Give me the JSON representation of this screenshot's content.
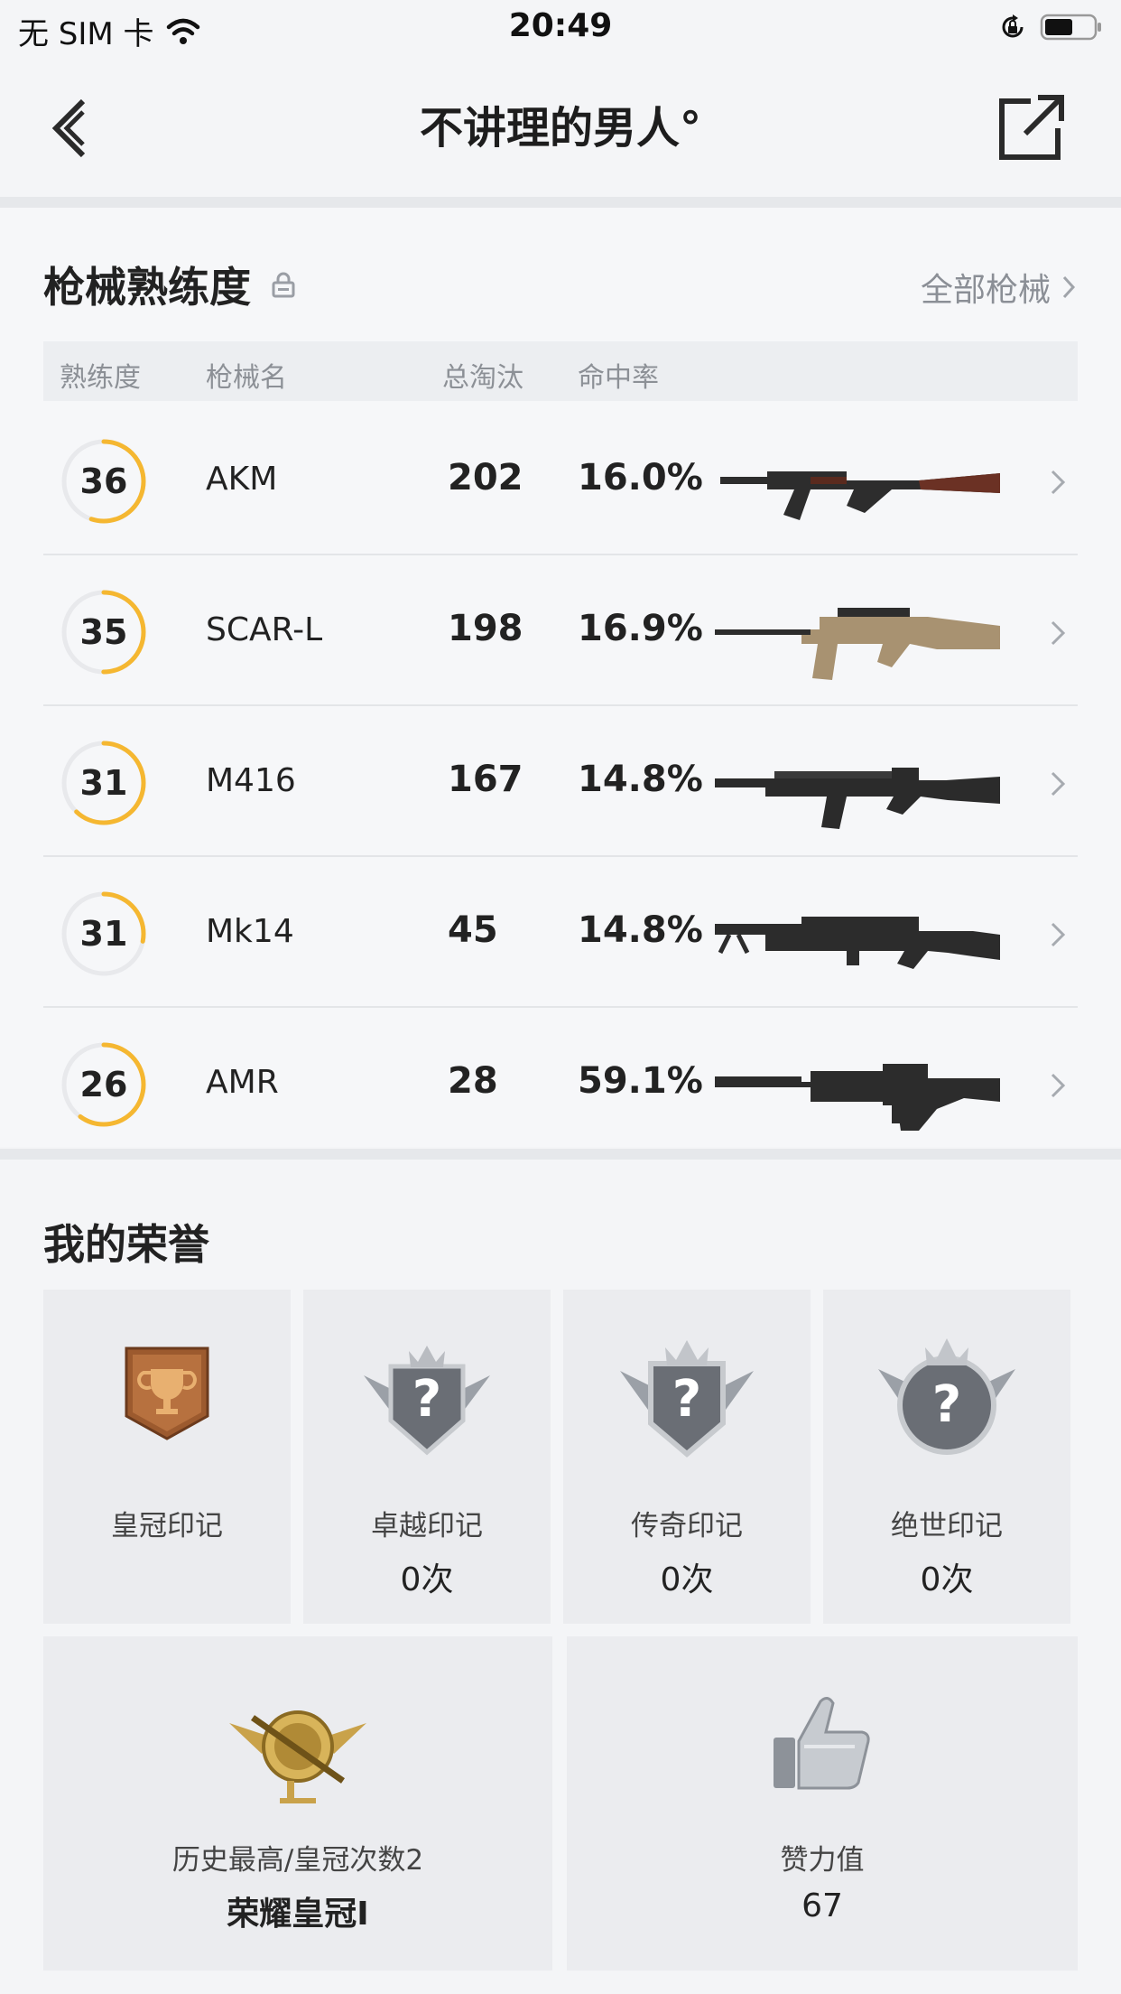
{
  "status_bar": {
    "carrier": "无 SIM 卡",
    "time": "20:49"
  },
  "nav": {
    "title": "不讲理的男人°"
  },
  "weapons": {
    "title": "枪械熟练度",
    "all_link": "全部枪械",
    "headers": {
      "mastery": "熟练度",
      "name": "枪械名",
      "kills": "总淘汰",
      "hit_rate": "命中率"
    },
    "rows": [
      {
        "mastery": "36",
        "progress": 0.55,
        "name": "AKM",
        "kills": "202",
        "hit_rate": "16.0%",
        "gun": "akm"
      },
      {
        "mastery": "35",
        "progress": 0.5,
        "name": "SCAR-L",
        "kills": "198",
        "hit_rate": "16.9%",
        "gun": "scar"
      },
      {
        "mastery": "31",
        "progress": 0.62,
        "name": "M416",
        "kills": "167",
        "hit_rate": "14.8%",
        "gun": "m416"
      },
      {
        "mastery": "31",
        "progress": 0.28,
        "name": "Mk14",
        "kills": "45",
        "hit_rate": "14.8%",
        "gun": "mk14"
      },
      {
        "mastery": "26",
        "progress": 0.6,
        "name": "AMR",
        "kills": "28",
        "hit_rate": "59.1%",
        "gun": "amr"
      }
    ]
  },
  "honors": {
    "title": "我的荣誉",
    "marks": [
      {
        "label": "皇冠印记",
        "value": ""
      },
      {
        "label": "卓越印记",
        "value": "0次"
      },
      {
        "label": "传奇印记",
        "value": "0次"
      },
      {
        "label": "绝世印记",
        "value": "0次"
      }
    ],
    "best": {
      "label": "历史最高/皇冠次数2",
      "value": "荣耀皇冠Ⅰ"
    },
    "likes": {
      "label": "赞力值",
      "value": "67"
    }
  },
  "colors": {
    "accent": "#f5b731",
    "ring_track": "#e8e9ec",
    "bronze": "#a8683a",
    "gold": "#c9a24a"
  }
}
